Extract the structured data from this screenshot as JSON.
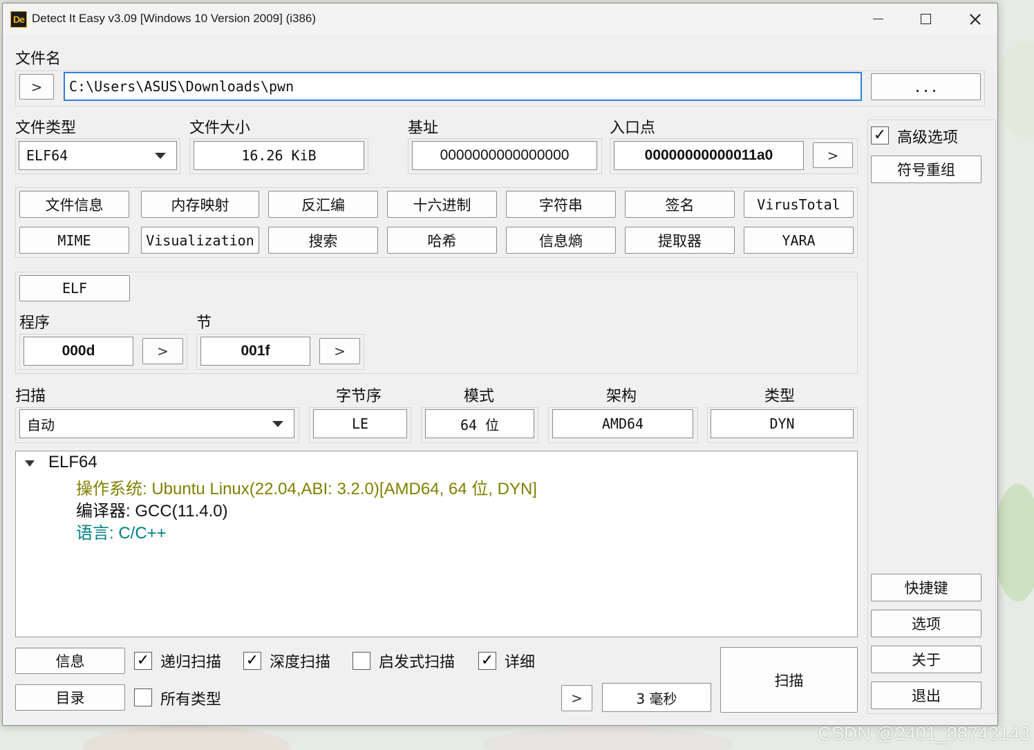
{
  "window": {
    "icon_text": "De",
    "title": "Detect It Easy v3.09 [Windows 10 Version 2009] (i386)"
  },
  "file": {
    "label": "文件名",
    "expand_button": ">",
    "path": "C:\\Users\\ASUS\\Downloads\\pwn",
    "browse_button": "..."
  },
  "info": {
    "file_type_label": "文件类型",
    "file_type_value": "ELF64",
    "file_size_label": "文件大小",
    "file_size_value": "16.26 KiB",
    "base_label": "基址",
    "base_value": "0000000000000000",
    "entry_label": "入口点",
    "entry_value": "00000000000011a0",
    "entry_button": ">"
  },
  "right_panel": {
    "advanced_label": "高级选项",
    "advanced_checked": true,
    "demangle_button": "符号重组",
    "shortcuts_button": "快捷键",
    "options_button": "选项",
    "about_button": "关于",
    "exit_button": "退出"
  },
  "tools": [
    [
      "文件信息",
      "内存映射",
      "反汇编",
      "十六进制",
      "字符串",
      "签名",
      "VirusTotal"
    ],
    [
      "MIME",
      "Visualization",
      "搜索",
      "哈希",
      "信息熵",
      "提取器",
      "YARA"
    ]
  ],
  "format": {
    "elf_button": "ELF",
    "program_label": "程序",
    "program_value": "000d",
    "program_button": ">",
    "section_label": "节",
    "section_value": "001f",
    "section_button": ">"
  },
  "scan": {
    "scan_label": "扫描",
    "scan_mode": "自动",
    "endian_label": "字节序",
    "endian_value": "LE",
    "mode_label": "模式",
    "mode_value": "64 位",
    "arch_label": "架构",
    "arch_value": "AMD64",
    "type_label": "类型",
    "type_value": "DYN"
  },
  "result": {
    "root": "ELF64",
    "lines": [
      {
        "text": "操作系统: Ubuntu Linux(22.04,ABI: 3.2.0)[AMD64, 64 位, DYN]",
        "color": "#808000"
      },
      {
        "text": "编译器: GCC(11.4.0)",
        "color": "#111111"
      },
      {
        "text": "语言: C/C++",
        "color": "#008080"
      }
    ]
  },
  "bottom": {
    "info_button": "信息",
    "dir_button": "目录",
    "recursive_label": "递归扫描",
    "recursive_checked": true,
    "deep_label": "深度扫描",
    "deep_checked": true,
    "heuristic_label": "启发式扫描",
    "heuristic_checked": false,
    "verbose_label": "详细",
    "verbose_checked": true,
    "all_types_label": "所有类型",
    "all_types_checked": false,
    "time_button": ">",
    "time_value": "3 毫秒",
    "scan_button": "扫描"
  },
  "watermark": "CSDN @2401_88743143"
}
